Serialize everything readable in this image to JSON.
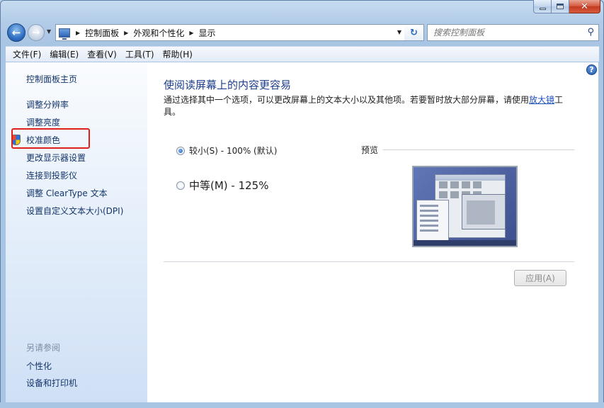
{
  "window": {
    "caption": {
      "minimize": "",
      "maximize": "",
      "close": "✕"
    }
  },
  "nav": {
    "back_glyph": "←",
    "forward_glyph": "→",
    "breadcrumb": [
      "控制面板",
      "外观和个性化",
      "显示"
    ],
    "search_placeholder": "搜索控制面板"
  },
  "menu": [
    {
      "label": "文件(F)"
    },
    {
      "label": "编辑(E)"
    },
    {
      "label": "查看(V)"
    },
    {
      "label": "工具(T)"
    },
    {
      "label": "帮助(H)"
    }
  ],
  "sidebar": {
    "home": "控制面板主页",
    "links": [
      "调整分辨率",
      "调整亮度",
      "校准颜色",
      "更改显示器设置",
      "连接到投影仪",
      "调整 ClearType 文本",
      "设置自定义文本大小(DPI)"
    ],
    "see_also_header": "另请参阅",
    "see_also": [
      "个性化",
      "设备和打印机"
    ]
  },
  "main": {
    "title": "使阅读屏幕上的内容更容易",
    "desc_before": "通过选择其中一个选项，可以更改屏幕上的文本大小以及其他项。若要暂时放大部分屏幕，请使用",
    "desc_link": "放大镜",
    "desc_after": "工具。",
    "options": [
      {
        "label": "较小(S) - 100% (默认)",
        "checked": true
      },
      {
        "label": "中等(M) - 125%",
        "checked": false
      }
    ],
    "preview_label": "预览",
    "apply_label": "应用(A)",
    "help_glyph": "?"
  },
  "colors": {
    "link": "#14356a",
    "title": "#1e3f8c",
    "highlight": "#e0201b"
  }
}
